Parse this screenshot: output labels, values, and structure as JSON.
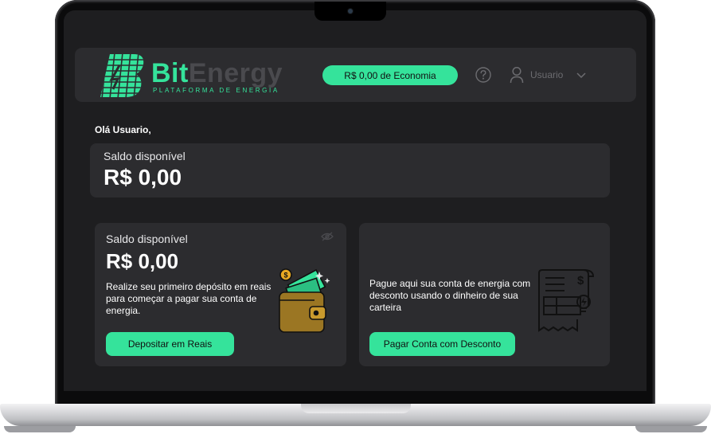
{
  "brand": {
    "name_part1": "Bit",
    "name_part2": "Energy",
    "tagline": "PLATAFORMA DE ENERGIA",
    "color": "#35e39b"
  },
  "header": {
    "savings_label": "R$ 0,00 de Economia",
    "help_icon": "help-circle-icon",
    "user_icon": "user-icon",
    "user_name": "Usuario",
    "dropdown_icon": "chevron-down-icon"
  },
  "greeting": "Olá Usuario,",
  "balance": {
    "label": "Saldo disponível",
    "value": "R$ 0,00"
  },
  "deposit_card": {
    "label": "Saldo disponível",
    "value": "R$ 0,00",
    "description_lines": [
      "Realize seu primeiro depósito em reais",
      "para começar a pagar sua conta de",
      "energia."
    ],
    "button": "Depositar em Reais",
    "visibility_icon": "eye-off-icon",
    "illustration": "wallet-money-icon"
  },
  "bill_card": {
    "description_lines": [
      "Pague aqui sua conta de energia com",
      "desconto usando o dinheiro de sua",
      "carteira"
    ],
    "button": "Pagar Conta com Desconto",
    "illustration": "energy-bill-icon"
  }
}
